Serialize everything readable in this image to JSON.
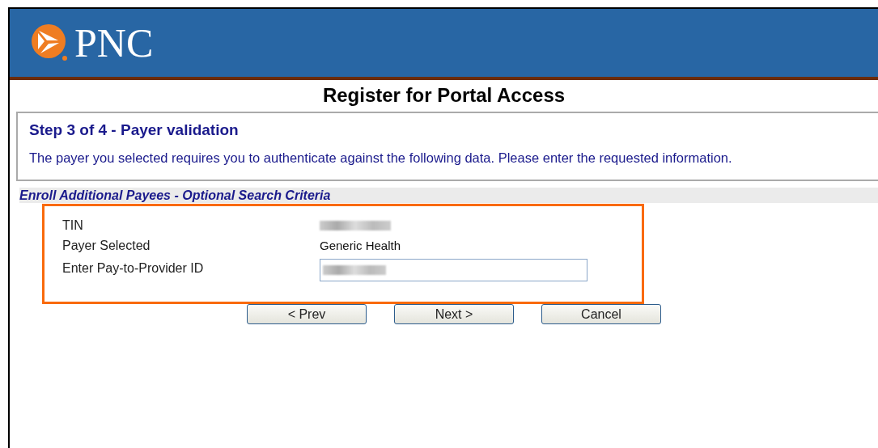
{
  "header": {
    "logo_text": "PNC"
  },
  "page_title": "Register for Portal Access",
  "step": {
    "title": "Step 3 of 4 - Payer validation",
    "description": "The payer you selected requires you to authenticate against the following data. Please enter the requested information."
  },
  "section_heading": "Enroll Additional Payees - Optional Search Criteria",
  "fields": [
    {
      "kind": "redacted",
      "label": "TIN"
    },
    {
      "kind": "text",
      "label": "Payer Selected",
      "value": "Generic Health"
    },
    {
      "kind": "input",
      "label": "Enter Pay-to-Provider ID"
    }
  ],
  "buttons": [
    "< Prev",
    "Next >",
    "Cancel"
  ]
}
